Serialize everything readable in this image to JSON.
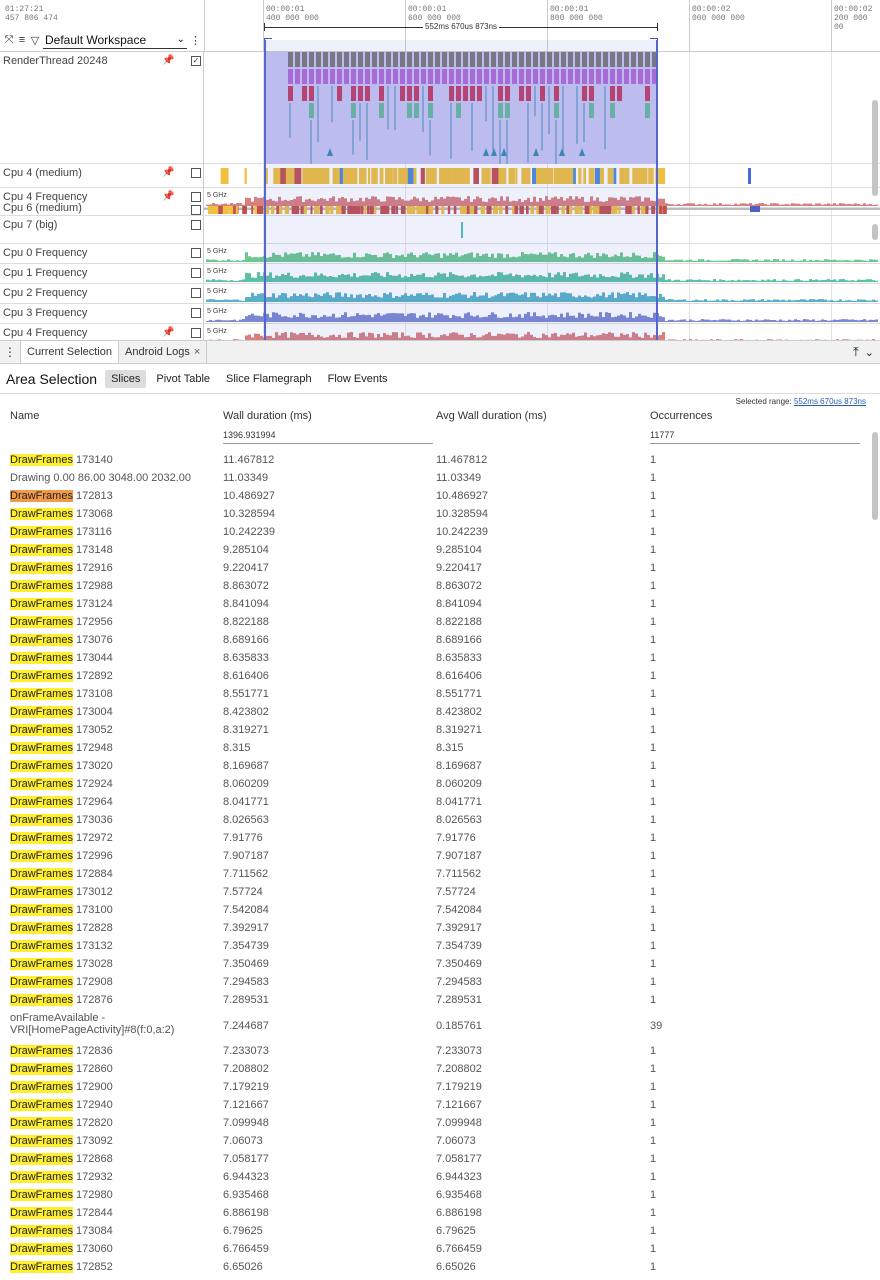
{
  "timeline": {
    "start_time": [
      "01:27:21",
      "457 806 474"
    ],
    "ticks": [
      {
        "l1": "00:00:01",
        "l2": "400 000 000"
      },
      {
        "l1": "00:00:01",
        "l2": "600 000 000"
      },
      {
        "l1": "00:00:01",
        "l2": "800 000 000"
      },
      {
        "l1": "00:00:02",
        "l2": "000 000 000"
      },
      {
        "l1": "00:00:02",
        "l2": "200 000 00"
      }
    ],
    "workspace": "Default Workspace",
    "range_label": "552ms 670us 873ns",
    "tracks_upper": [
      {
        "name": "RenderThread 20248",
        "pinned": true,
        "checked": true
      },
      {
        "name": "Cpu 4 (medium)",
        "pinned": true,
        "checked": false
      },
      {
        "name": "Cpu 4 Frequency",
        "pinned": true,
        "checked": false,
        "freq": "5 GHz"
      }
    ],
    "tracks_lower": [
      {
        "name": "Cpu 6 (medium)",
        "pinned": false,
        "checked": false
      },
      {
        "name": "Cpu 7 (big)",
        "pinned": false,
        "checked": false
      },
      {
        "name": "Cpu 0 Frequency",
        "pinned": false,
        "checked": false,
        "freq": "5 GHz"
      },
      {
        "name": "Cpu 1 Frequency",
        "pinned": false,
        "checked": false,
        "freq": "5 GHz"
      },
      {
        "name": "Cpu 2 Frequency",
        "pinned": false,
        "checked": false,
        "freq": "5 GHz"
      },
      {
        "name": "Cpu 3 Frequency",
        "pinned": false,
        "checked": false,
        "freq": "5 GHz"
      },
      {
        "name": "Cpu 4 Frequency",
        "pinned": true,
        "checked": false,
        "freq": "5 GHz"
      }
    ]
  },
  "tabs": {
    "current": "Current Selection",
    "logs": "Android Logs"
  },
  "area": {
    "title": "Area Selection",
    "subtabs": [
      "Slices",
      "Pivot Table",
      "Slice Flamegraph",
      "Flow Events"
    ],
    "selected_range_label": "Selected range:",
    "selected_range_value": "552ms 670us 873ns"
  },
  "table": {
    "headers": {
      "name": "Name",
      "wall": "Wall duration (ms)",
      "avg": "Avg Wall duration (ms)",
      "occ": "Occurrences"
    },
    "totals": {
      "wall": "1396.931994",
      "occ": "11777"
    },
    "rows": [
      {
        "hl": "DrawFrames",
        "rest": " 173140",
        "wall": "11.467812",
        "avg": "11.467812",
        "occ": "1"
      },
      {
        "hl": "",
        "rest": "Drawing 0.00 86.00 3048.00 2032.00",
        "wall": "11.03349",
        "avg": "11.03349",
        "occ": "1"
      },
      {
        "hl": "DrawFrames",
        "hl_orange": true,
        "rest": " 172813",
        "wall": "10.486927",
        "avg": "10.486927",
        "occ": "1"
      },
      {
        "hl": "DrawFrames",
        "rest": " 173068",
        "wall": "10.328594",
        "avg": "10.328594",
        "occ": "1"
      },
      {
        "hl": "DrawFrames",
        "rest": " 173116",
        "wall": "10.242239",
        "avg": "10.242239",
        "occ": "1"
      },
      {
        "hl": "DrawFrames",
        "rest": " 173148",
        "wall": "9.285104",
        "avg": "9.285104",
        "occ": "1"
      },
      {
        "hl": "DrawFrames",
        "rest": " 172916",
        "wall": "9.220417",
        "avg": "9.220417",
        "occ": "1"
      },
      {
        "hl": "DrawFrames",
        "rest": " 172988",
        "wall": "8.863072",
        "avg": "8.863072",
        "occ": "1"
      },
      {
        "hl": "DrawFrames",
        "rest": " 173124",
        "wall": "8.841094",
        "avg": "8.841094",
        "occ": "1"
      },
      {
        "hl": "DrawFrames",
        "rest": " 172956",
        "wall": "8.822188",
        "avg": "8.822188",
        "occ": "1"
      },
      {
        "hl": "DrawFrames",
        "rest": " 173076",
        "wall": "8.689166",
        "avg": "8.689166",
        "occ": "1"
      },
      {
        "hl": "DrawFrames",
        "rest": " 173044",
        "wall": "8.635833",
        "avg": "8.635833",
        "occ": "1"
      },
      {
        "hl": "DrawFrames",
        "rest": " 172892",
        "wall": "8.616406",
        "avg": "8.616406",
        "occ": "1"
      },
      {
        "hl": "DrawFrames",
        "rest": " 173108",
        "wall": "8.551771",
        "avg": "8.551771",
        "occ": "1"
      },
      {
        "hl": "DrawFrames",
        "rest": " 173004",
        "wall": "8.423802",
        "avg": "8.423802",
        "occ": "1"
      },
      {
        "hl": "DrawFrames",
        "rest": " 173052",
        "wall": "8.319271",
        "avg": "8.319271",
        "occ": "1"
      },
      {
        "hl": "DrawFrames",
        "rest": " 172948",
        "wall": "8.315",
        "avg": "8.315",
        "occ": "1"
      },
      {
        "hl": "DrawFrames",
        "rest": " 173020",
        "wall": "8.169687",
        "avg": "8.169687",
        "occ": "1"
      },
      {
        "hl": "DrawFrames",
        "rest": " 172924",
        "wall": "8.060209",
        "avg": "8.060209",
        "occ": "1"
      },
      {
        "hl": "DrawFrames",
        "rest": " 172964",
        "wall": "8.041771",
        "avg": "8.041771",
        "occ": "1"
      },
      {
        "hl": "DrawFrames",
        "rest": " 173036",
        "wall": "8.026563",
        "avg": "8.026563",
        "occ": "1"
      },
      {
        "hl": "DrawFrames",
        "rest": " 172972",
        "wall": "7.91776",
        "avg": "7.91776",
        "occ": "1"
      },
      {
        "hl": "DrawFrames",
        "rest": " 172996",
        "wall": "7.907187",
        "avg": "7.907187",
        "occ": "1"
      },
      {
        "hl": "DrawFrames",
        "rest": " 172884",
        "wall": "7.711562",
        "avg": "7.711562",
        "occ": "1"
      },
      {
        "hl": "DrawFrames",
        "rest": " 173012",
        "wall": "7.57724",
        "avg": "7.57724",
        "occ": "1"
      },
      {
        "hl": "DrawFrames",
        "rest": " 173100",
        "wall": "7.542084",
        "avg": "7.542084",
        "occ": "1"
      },
      {
        "hl": "DrawFrames",
        "rest": " 172828",
        "wall": "7.392917",
        "avg": "7.392917",
        "occ": "1"
      },
      {
        "hl": "DrawFrames",
        "rest": " 173132",
        "wall": "7.354739",
        "avg": "7.354739",
        "occ": "1"
      },
      {
        "hl": "DrawFrames",
        "rest": " 173028",
        "wall": "7.350469",
        "avg": "7.350469",
        "occ": "1"
      },
      {
        "hl": "DrawFrames",
        "rest": " 172908",
        "wall": "7.294583",
        "avg": "7.294583",
        "occ": "1"
      },
      {
        "hl": "DrawFrames",
        "rest": " 172876",
        "wall": "7.289531",
        "avg": "7.289531",
        "occ": "1"
      },
      {
        "hl": "",
        "rest": "onFrameAvailable - VRI[HomePageActivity]#8(f:0,a:2)",
        "wall": "7.244687",
        "avg": "0.185761",
        "occ": "39",
        "tall": true
      },
      {
        "hl": "DrawFrames",
        "rest": " 172836",
        "wall": "7.233073",
        "avg": "7.233073",
        "occ": "1"
      },
      {
        "hl": "DrawFrames",
        "rest": " 172860",
        "wall": "7.208802",
        "avg": "7.208802",
        "occ": "1"
      },
      {
        "hl": "DrawFrames",
        "rest": " 172900",
        "wall": "7.179219",
        "avg": "7.179219",
        "occ": "1"
      },
      {
        "hl": "DrawFrames",
        "rest": " 172940",
        "wall": "7.121667",
        "avg": "7.121667",
        "occ": "1"
      },
      {
        "hl": "DrawFrames",
        "rest": " 172820",
        "wall": "7.099948",
        "avg": "7.099948",
        "occ": "1"
      },
      {
        "hl": "DrawFrames",
        "rest": " 173092",
        "wall": "7.06073",
        "avg": "7.06073",
        "occ": "1"
      },
      {
        "hl": "DrawFrames",
        "rest": " 172868",
        "wall": "7.058177",
        "avg": "7.058177",
        "occ": "1"
      },
      {
        "hl": "DrawFrames",
        "rest": " 172932",
        "wall": "6.944323",
        "avg": "6.944323",
        "occ": "1"
      },
      {
        "hl": "DrawFrames",
        "rest": " 172980",
        "wall": "6.935468",
        "avg": "6.935468",
        "occ": "1"
      },
      {
        "hl": "DrawFrames",
        "rest": " 172844",
        "wall": "6.886198",
        "avg": "6.886198",
        "occ": "1"
      },
      {
        "hl": "DrawFrames",
        "rest": " 173084",
        "wall": "6.79625",
        "avg": "6.79625",
        "occ": "1"
      },
      {
        "hl": "DrawFrames",
        "rest": " 173060",
        "wall": "6.766459",
        "avg": "6.766459",
        "occ": "1"
      },
      {
        "hl": "DrawFrames",
        "rest": " 172852",
        "wall": "6.65026",
        "avg": "6.65026",
        "occ": "1"
      }
    ]
  },
  "colors": {
    "highlight": "#ffef2e",
    "highlight_selected": "#f09a4a",
    "selection": "#5566cc",
    "cpu_slice": "#f0c040",
    "freq_red": "#d88080",
    "freq_green": "#6cc890"
  }
}
